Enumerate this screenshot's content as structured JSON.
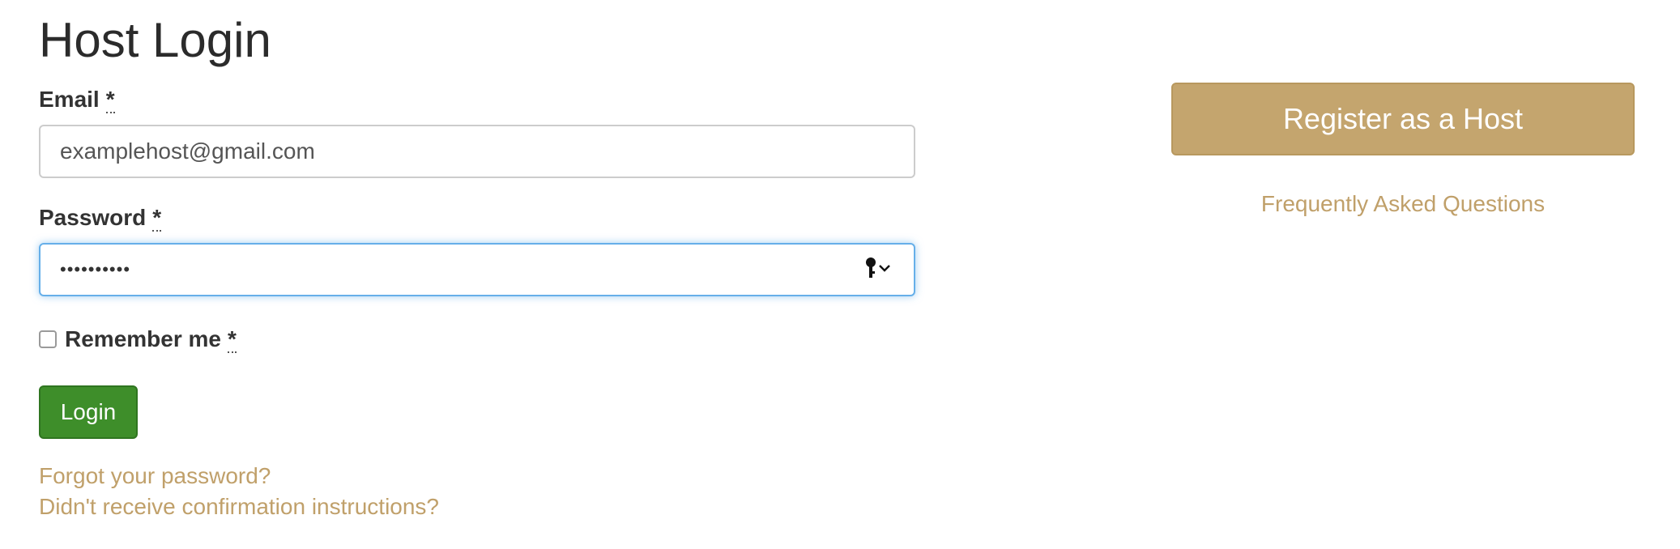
{
  "page": {
    "title": "Host Login"
  },
  "form": {
    "email_label": "Email",
    "email_value": "examplehost@gmail.com",
    "password_label": "Password",
    "password_value": "••••••••••",
    "remember_label": "Remember me",
    "required_marker": "*",
    "login_label": "Login"
  },
  "links": {
    "forgot_password": "Forgot your password?",
    "no_confirmation": "Didn't receive confirmation instructions?"
  },
  "sidebar": {
    "register_label": "Register as a Host",
    "faq_label": "Frequently Asked Questions"
  },
  "icons": {
    "password_manager": "key-icon",
    "dropdown": "chevron-down-icon"
  },
  "colors": {
    "accent_gold": "#c4a56e",
    "link_gold": "#c0a06a",
    "login_green": "#3e8e2a",
    "focus_blue": "#66afe9"
  }
}
